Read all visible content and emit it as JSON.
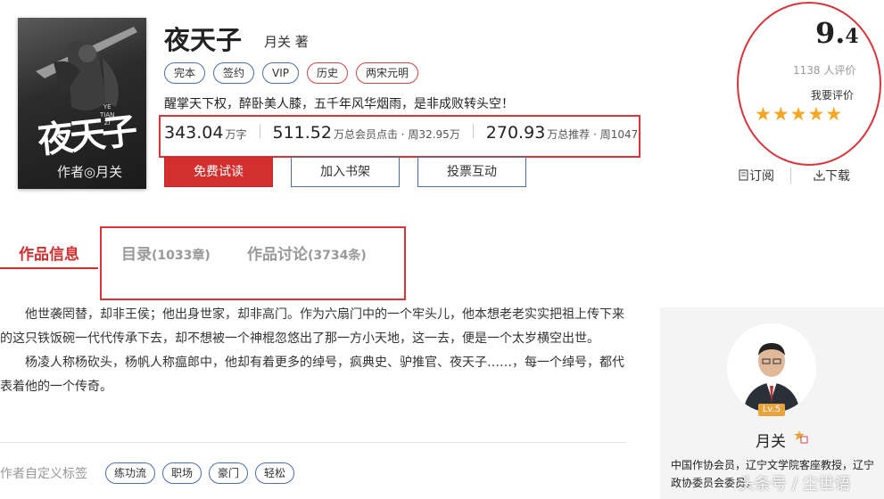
{
  "book": {
    "cover_title": "夜天子",
    "cover_pinyin_1": "YE",
    "cover_pinyin_2": "TIAN",
    "cover_pinyin_3": "ZI",
    "cover_author": "作者◎月关",
    "title": "夜天子",
    "author": "月关 著",
    "tags": [
      "完本",
      "签约",
      "VIP",
      "历史",
      "两宋元明"
    ],
    "description": "醒掌天下权，醉卧美人膝，五千年风华烟雨，是非成败转头空！",
    "stats": {
      "words_num": "343.04",
      "words_unit": "万字",
      "clicks_num": "511.52",
      "clicks_unit": "万总会员点击 · 周32.95万",
      "recs_num": "270.93",
      "recs_unit": "万总推荐 · 周1047"
    },
    "buttons": {
      "read": "免费试读",
      "shelf": "加入书架",
      "vote": "投票互动"
    }
  },
  "rating": {
    "score_int": "9.",
    "score_dec": "4",
    "count": "1138 人评价",
    "rate_label": "我要评价",
    "stars": [
      "★",
      "★",
      "★",
      "★",
      "★"
    ],
    "star_color": "#f5a623",
    "subscribe": "订阅",
    "download": "下载"
  },
  "tabs": {
    "info": "作品信息",
    "catalog": "目录",
    "catalog_count": "(1033章)",
    "discuss": "作品讨论",
    "discuss_count": "(3734条)"
  },
  "intro": {
    "p1": "他世袭罔替，却非王侯；他出身世家，却非高门。作为六扇门中的一个牢头儿，他本想老老实实把祖上传下来的这只铁饭碗一代代传承下去，却不想被一个神棍忽悠出了那一方小天地，这一去，便是一个太岁横空出世。",
    "p2": "杨凌人称杨砍头，杨帆人称瘟郎中，他却有着更多的绰号，疯典史、驴推官、夜天子……，每一个绰号，都代表着他的一个传奇。"
  },
  "custom_tags": {
    "label": "作者自定义标签",
    "items": [
      "练功流",
      "职场",
      "豪门",
      "轻松"
    ]
  },
  "author_card": {
    "level": "Lv.5",
    "name": "月关",
    "desc": "中国作协会员，辽宁文学院客座教授，辽宁政协委员会委员。"
  },
  "watermark": "头条号 / 尘世语",
  "colors": {
    "accent": "#d32f2f",
    "tag_border": "#4a6ea8",
    "highlight_box": "#d9343a"
  }
}
